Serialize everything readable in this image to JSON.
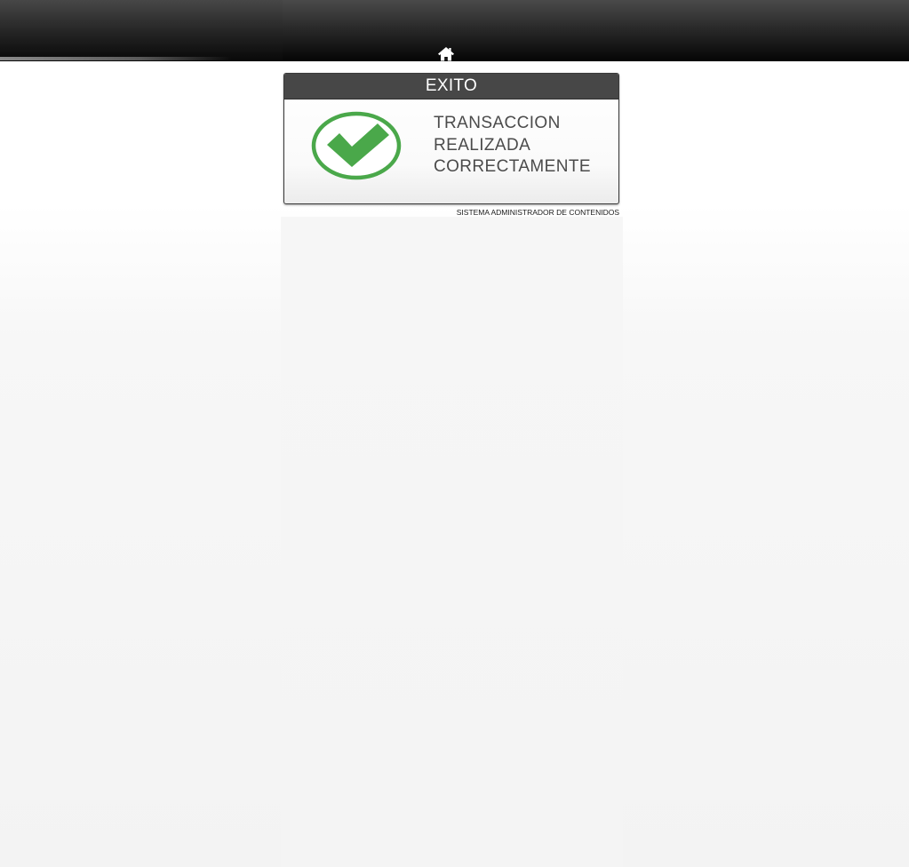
{
  "header": {
    "home_icon": "home-icon"
  },
  "dialog": {
    "title": "EXITO",
    "status_icon": "check-circle-icon",
    "message_lines": [
      "TRANSACCION",
      "REALIZADA",
      "CORRECTAMENTE"
    ]
  },
  "footer": {
    "caption": "SISTEMA ADMINISTRADOR DE CONTENIDOS"
  },
  "colors": {
    "header_dark": "#050505",
    "dialog_header": "#474747",
    "success_green": "#4aa84a"
  }
}
